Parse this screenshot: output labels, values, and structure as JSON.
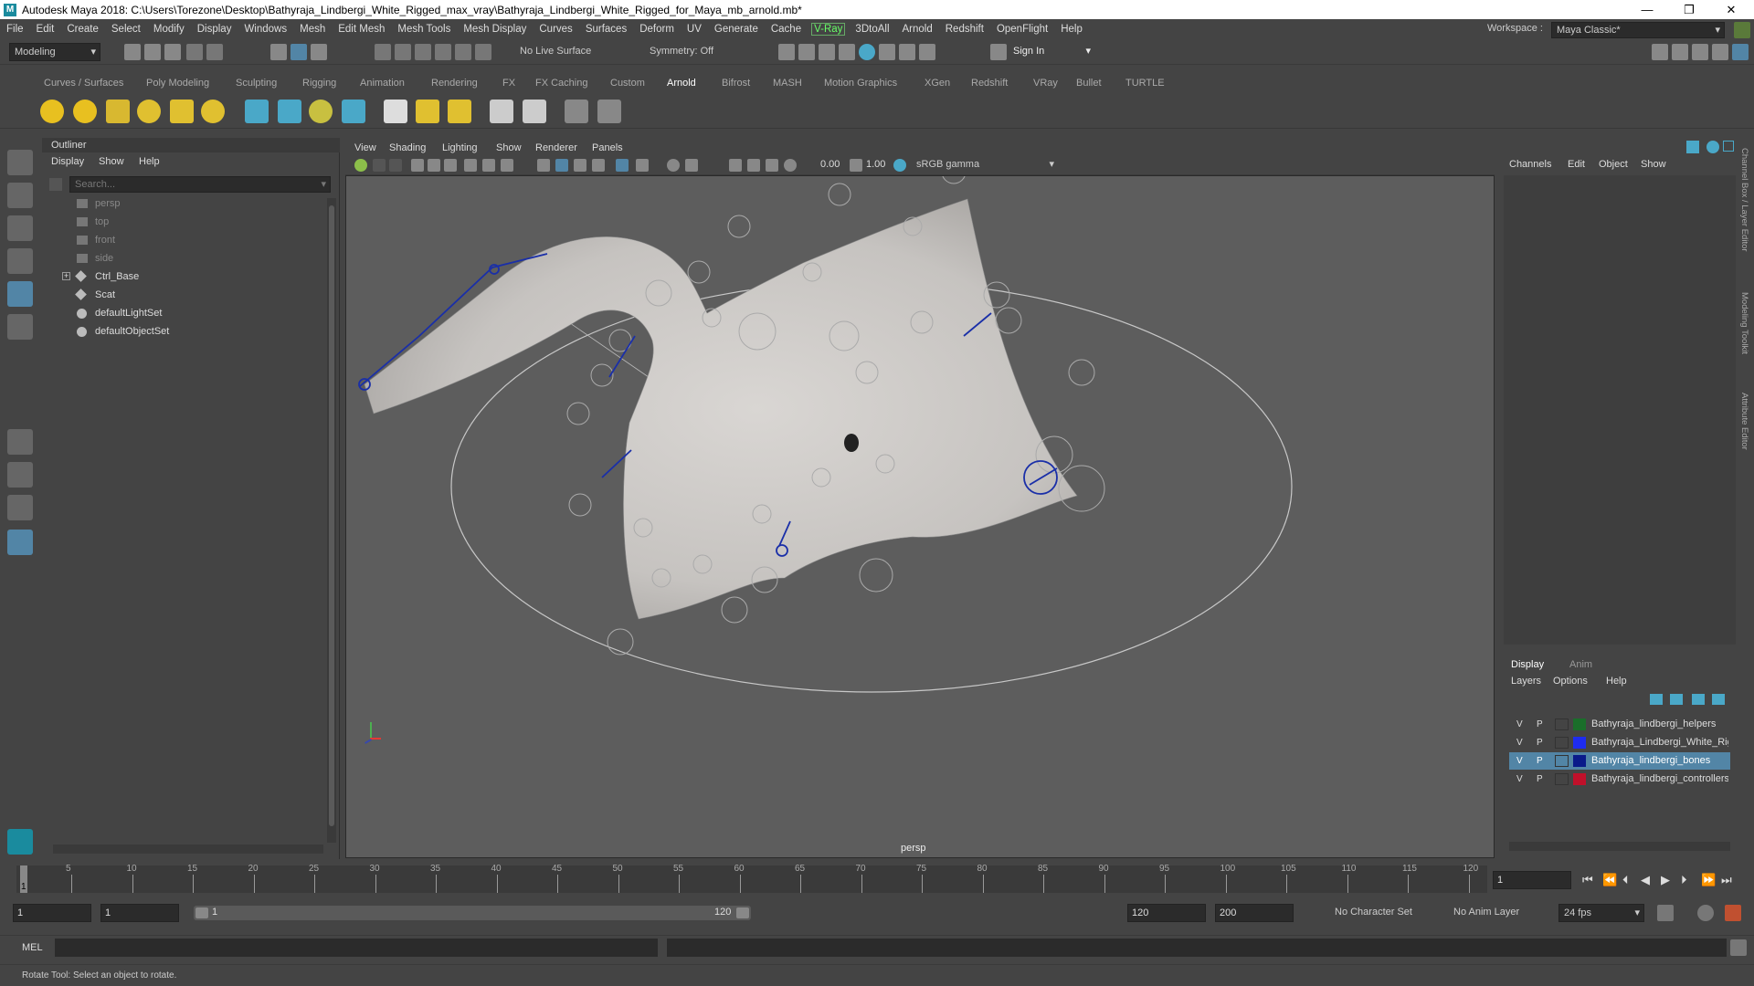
{
  "title_bar": {
    "logo": "M",
    "text": "Autodesk Maya 2018: C:\\Users\\Torezone\\Desktop\\Bathyraja_Lindbergi_White_Rigged_max_vray\\Bathyraja_Lindbergi_White_Rigged_for_Maya_mb_arnold.mb*",
    "minimize": "—",
    "maximize": "❐",
    "close": "✕"
  },
  "menu": [
    "File",
    "Edit",
    "Create",
    "Select",
    "Modify",
    "Display",
    "Windows",
    "Mesh",
    "Edit Mesh",
    "Mesh Tools",
    "Mesh Display",
    "Curves",
    "Surfaces",
    "Deform",
    "UV",
    "Generate",
    "Cache",
    "V-Ray",
    "3DtoAll",
    "Arnold",
    "Redshift",
    "OpenFlight",
    "Help"
  ],
  "workspace": {
    "label": "Workspace :",
    "value": "Maya Classic*"
  },
  "toolbar": {
    "mode": "Modeling",
    "live_surface": "No Live Surface",
    "symmetry": "Symmetry: Off",
    "sign_in": "Sign In"
  },
  "shelf_tabs": [
    "Curves / Surfaces",
    "Poly Modeling",
    "Sculpting",
    "Rigging",
    "Animation",
    "Rendering",
    "FX",
    "FX Caching",
    "Custom",
    "Arnold",
    "Bifrost",
    "MASH",
    "Motion Graphics",
    "XGen",
    "Redshift",
    "VRay",
    "Bullet",
    "TURTLE"
  ],
  "shelf_active": "Arnold",
  "outliner": {
    "title": "Outliner",
    "menu": [
      "Display",
      "Show",
      "Help"
    ],
    "search_placeholder": "Search...",
    "items": [
      {
        "label": "persp",
        "icon": "camera-icon",
        "dim": true
      },
      {
        "label": "top",
        "icon": "camera-icon",
        "dim": true
      },
      {
        "label": "front",
        "icon": "camera-icon",
        "dim": true
      },
      {
        "label": "side",
        "icon": "camera-icon",
        "dim": true
      },
      {
        "label": "Ctrl_Base",
        "icon": "transform-icon",
        "dim": false,
        "expandable": true
      },
      {
        "label": "Scat",
        "icon": "transform-icon",
        "dim": false
      },
      {
        "label": "defaultLightSet",
        "icon": "set-icon",
        "dim": false
      },
      {
        "label": "defaultObjectSet",
        "icon": "set-icon",
        "dim": false
      }
    ]
  },
  "viewport": {
    "menu": [
      "View",
      "Shading",
      "Lighting",
      "Show",
      "Renderer",
      "Panels"
    ],
    "exposure": "0.00",
    "gamma": "1.00",
    "color_space": "sRGB gamma",
    "camera_label": "persp"
  },
  "channel_box": {
    "menu": [
      "Channels",
      "Edit",
      "Object",
      "Show"
    ]
  },
  "side_tabs": [
    "Channel Box / Layer Editor",
    "Modeling Toolkit",
    "Attribute Editor"
  ],
  "layers": {
    "tabs": [
      "Display",
      "Anim"
    ],
    "menu": [
      "Layers",
      "Options",
      "Help"
    ],
    "rows": [
      {
        "v": "V",
        "p": "P",
        "color": "#1a6e2a",
        "name": "Bathyraja_lindbergi_helpers",
        "selected": false
      },
      {
        "v": "V",
        "p": "P",
        "color": "#1e2cf0",
        "name": "Bathyraja_Lindbergi_White_Rigged",
        "selected": false
      },
      {
        "v": "V",
        "p": "P",
        "color": "#0a1a8a",
        "name": "Bathyraja_lindbergi_bones",
        "selected": true
      },
      {
        "v": "V",
        "p": "P",
        "color": "#c0102a",
        "name": "Bathyraja_lindbergi_controllers",
        "selected": false
      }
    ]
  },
  "timeline": {
    "ticks": [
      "5",
      "10",
      "15",
      "20",
      "25",
      "30",
      "35",
      "40",
      "45",
      "50",
      "55",
      "60",
      "65",
      "70",
      "75",
      "80",
      "85",
      "90",
      "95",
      "100",
      "105",
      "110",
      "115",
      "120"
    ],
    "current_marker": "1",
    "current_frame": "1"
  },
  "range": {
    "start": "1",
    "anim_start": "1",
    "slider_start": "1",
    "slider_end": "120",
    "end": "120",
    "anim_end": "200",
    "character_set": "No Character Set",
    "anim_layer": "No Anim Layer",
    "fps": "24 fps"
  },
  "command": {
    "label": "MEL"
  },
  "help_line": "Rotate Tool: Select an object to rotate."
}
